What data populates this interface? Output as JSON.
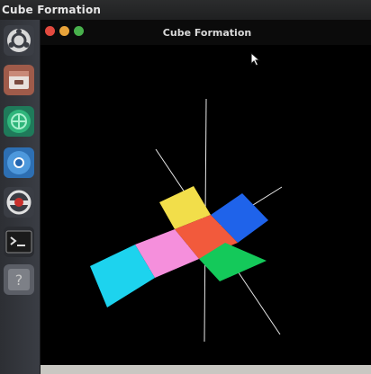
{
  "topbar": {
    "title": "Cube Formation"
  },
  "window": {
    "title": "Cube Formation",
    "controls": [
      {
        "name": "close",
        "color": "#e34a3f"
      },
      {
        "name": "minimize",
        "color": "#e8a33a"
      },
      {
        "name": "maximize",
        "color": "#48b04c"
      }
    ]
  },
  "launcher": {
    "items": [
      {
        "name": "ubuntu-logo-icon"
      },
      {
        "name": "files-icon"
      },
      {
        "name": "android-studio-icon"
      },
      {
        "name": "chromium-icon"
      },
      {
        "name": "software-updater-icon"
      },
      {
        "name": "terminal-icon"
      },
      {
        "name": "unknown-app-icon"
      }
    ]
  },
  "scene": {
    "faces": [
      {
        "name": "face-yellow",
        "color": "#f2de4a"
      },
      {
        "name": "face-blue",
        "color": "#1f63ea"
      },
      {
        "name": "face-red",
        "color": "#f25a3c"
      },
      {
        "name": "face-pink",
        "color": "#f58fdc"
      },
      {
        "name": "face-cyan",
        "color": "#1dd3ee"
      },
      {
        "name": "face-green",
        "color": "#14c95a"
      }
    ],
    "axis_color": "#e8e8e8"
  }
}
